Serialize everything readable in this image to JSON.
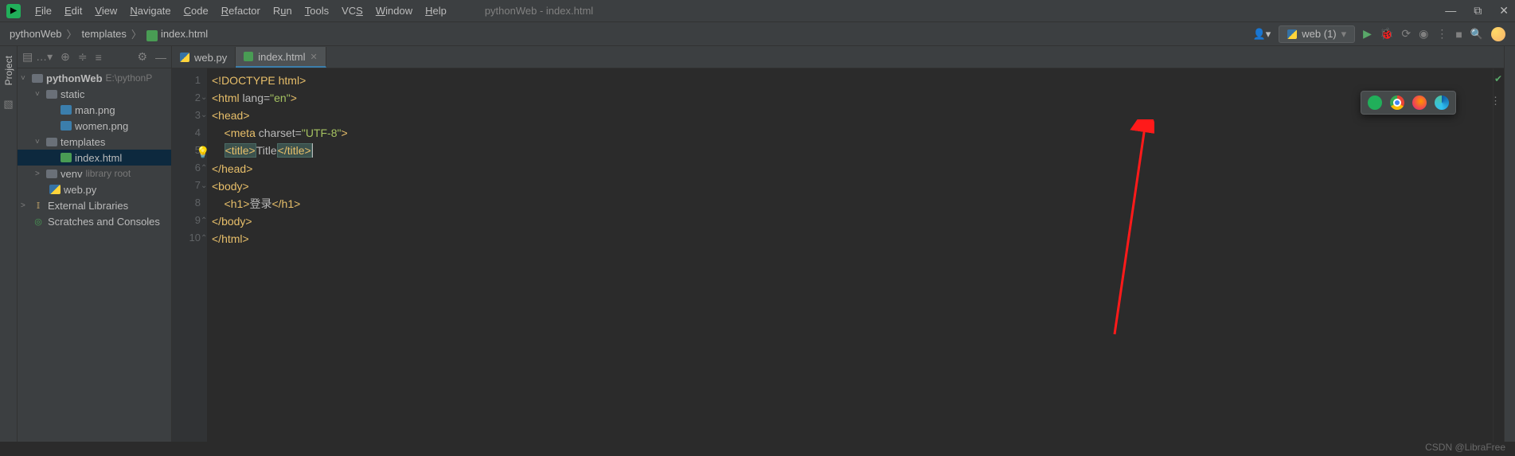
{
  "window": {
    "title": "pythonWeb - index.html"
  },
  "menu": {
    "file": "File",
    "edit": "Edit",
    "view": "View",
    "navigate": "Navigate",
    "code": "Code",
    "refactor": "Refactor",
    "run": "Run",
    "tools": "Tools",
    "vcs": "VCS",
    "window": "Window",
    "help": "Help"
  },
  "breadcrumbs": {
    "root": "pythonWeb",
    "folder": "templates",
    "file": "index.html"
  },
  "runconfig": {
    "label": "web (1)"
  },
  "sidebar": {
    "project_label": "Project"
  },
  "tree": {
    "root": "pythonWeb",
    "root_hint": "E:\\pythonP",
    "static": "static",
    "man": "man.png",
    "women": "women.png",
    "templates": "templates",
    "index": "index.html",
    "venv": "venv",
    "venv_hint": "library root",
    "webpy": "web.py",
    "ext_lib": "External Libraries",
    "scratches": "Scratches and Consoles"
  },
  "tabs": {
    "t1": "web.py",
    "t2": "index.html"
  },
  "code": {
    "l1": "<!DOCTYPE html>",
    "l2a": "<html ",
    "l2b": "lang=",
    "l2c": "\"en\"",
    "l2d": ">",
    "l3": "<head>",
    "l4a": "    <meta ",
    "l4b": "charset=",
    "l4c": "\"UTF-8\"",
    "l4d": ">",
    "l5a": "    ",
    "l5b": "<title>",
    "l5c": "Title",
    "l5d": "</title>",
    "l6": "</head>",
    "l7": "<body>",
    "l8a": "    <h1>",
    "l8b": "登录",
    "l8c": "</h1>",
    "l9": "</body>",
    "l10": "</html>"
  },
  "line_numbers": [
    "1",
    "2",
    "3",
    "4",
    "5",
    "6",
    "7",
    "8",
    "9",
    "10"
  ],
  "watermark": "CSDN @LibraFree"
}
